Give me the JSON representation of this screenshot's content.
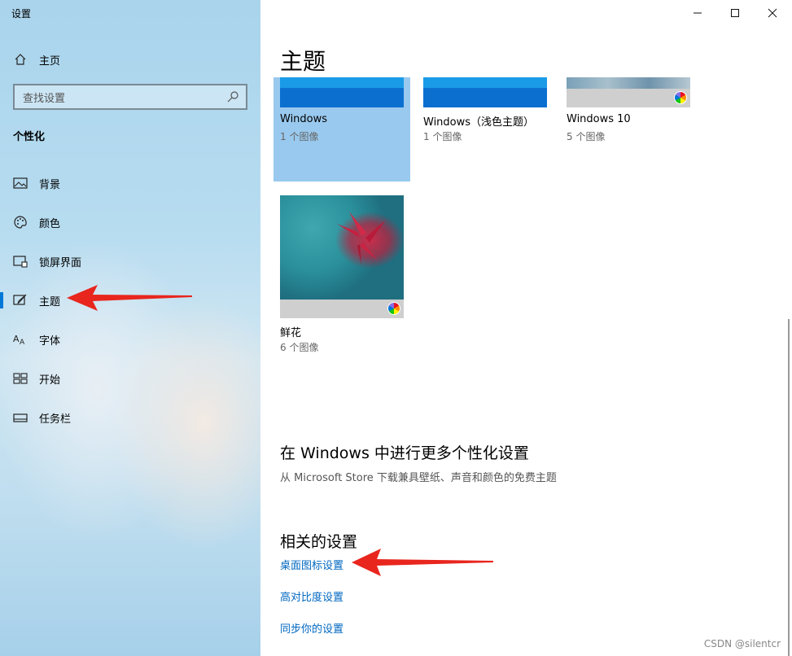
{
  "window": {
    "title": "设置"
  },
  "sidebar": {
    "home_label": "主页",
    "search_placeholder": "查找设置",
    "section": "个性化",
    "items": [
      {
        "label": "背景",
        "icon": "picture-icon"
      },
      {
        "label": "颜色",
        "icon": "palette-icon"
      },
      {
        "label": "锁屏界面",
        "icon": "lock-screen-icon"
      },
      {
        "label": "主题",
        "icon": "theme-brush-icon",
        "active": true
      },
      {
        "label": "字体",
        "icon": "font-icon"
      },
      {
        "label": "开始",
        "icon": "start-grid-icon"
      },
      {
        "label": "任务栏",
        "icon": "taskbar-icon"
      }
    ]
  },
  "main": {
    "title": "主题",
    "themes": [
      {
        "name": "Windows",
        "count": "1 个图像",
        "selected": true
      },
      {
        "name": "Windows（浅色主题）",
        "count": "1 个图像"
      },
      {
        "name": "Windows 10",
        "count": "5 个图像"
      },
      {
        "name": "鲜花",
        "count": "6 个图像"
      }
    ],
    "more": {
      "heading": "在 Windows 中进行更多个性化设置",
      "desc": "从 Microsoft Store 下载兼具壁纸、声音和颜色的免费主题"
    },
    "related": {
      "heading": "相关的设置",
      "links": [
        "桌面图标设置",
        "高对比度设置",
        "同步你的设置"
      ]
    }
  },
  "colors": {
    "accent": "#0078d7",
    "link": "#0067c0",
    "selected_tile": "#99c9ee",
    "annotation_arrow": "#e8261e"
  },
  "watermark": "CSDN @silentcr"
}
